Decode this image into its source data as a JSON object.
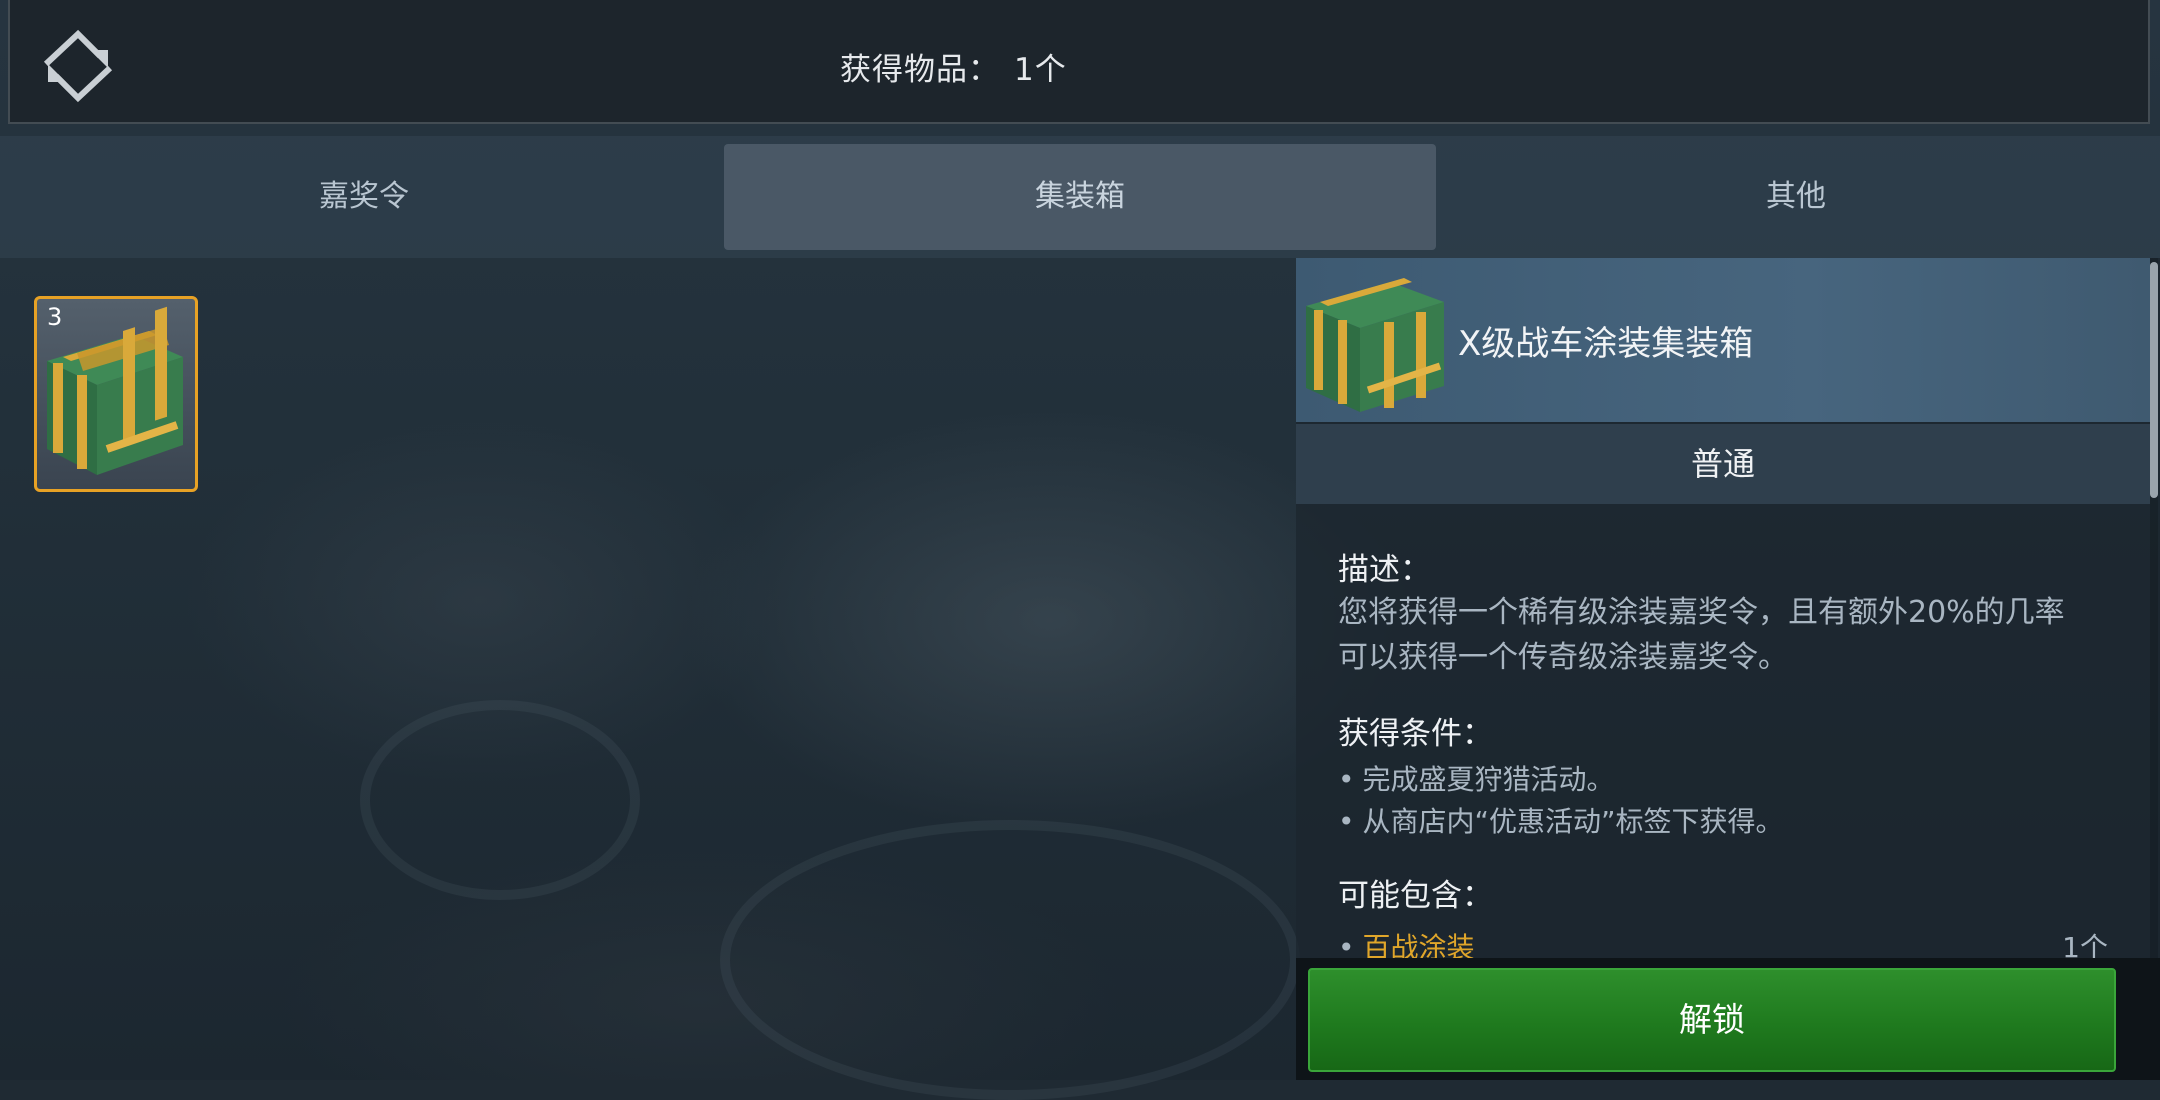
{
  "header": {
    "title": "获得物品：",
    "count": "1个"
  },
  "tabs": [
    {
      "label": "嘉奖令",
      "active": false
    },
    {
      "label": "集装箱",
      "active": true
    },
    {
      "label": "其他",
      "active": false
    }
  ],
  "inventory": {
    "items": [
      {
        "icon": "container-icon",
        "count": "3",
        "selected": true
      }
    ]
  },
  "detail": {
    "title": "X级战车涂装集装箱",
    "rarity": "普通",
    "description_heading": "描述：",
    "description_lines": [
      "您将获得一个稀有级涂装嘉奖令，且有额外20%的几率",
      "可以获得一个传奇级涂装嘉奖令。"
    ],
    "conditions_heading": "获得条件：",
    "conditions": [
      "完成盛夏狩猎活动。",
      "从商店内“优惠活动”标签下获得。"
    ],
    "contents_heading": "可能包含：",
    "contents": [
      {
        "name": "百战涂装",
        "qty": "1个"
      }
    ]
  },
  "actions": {
    "unlock_label": "解锁"
  },
  "colors": {
    "selected_border": "#e8a225",
    "unlock_green": "#1f7a1e",
    "contents_gold": "#e0a62a"
  }
}
